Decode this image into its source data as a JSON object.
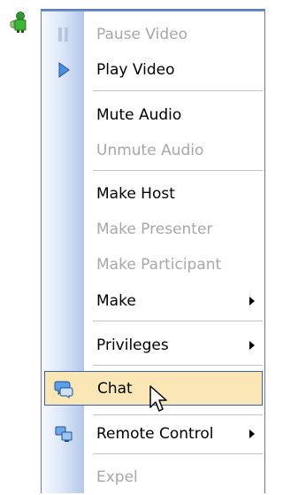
{
  "menu": {
    "items": [
      {
        "label": "Pause Video"
      },
      {
        "label": "Play Video"
      },
      {
        "label": "Mute Audio"
      },
      {
        "label": "Unmute Audio"
      },
      {
        "label": "Make Host"
      },
      {
        "label": "Make Presenter"
      },
      {
        "label": "Make Participant"
      },
      {
        "label": "Make"
      },
      {
        "label": "Privileges"
      },
      {
        "label": "Chat"
      },
      {
        "label": "Remote Control"
      },
      {
        "label": "Expel"
      }
    ]
  }
}
